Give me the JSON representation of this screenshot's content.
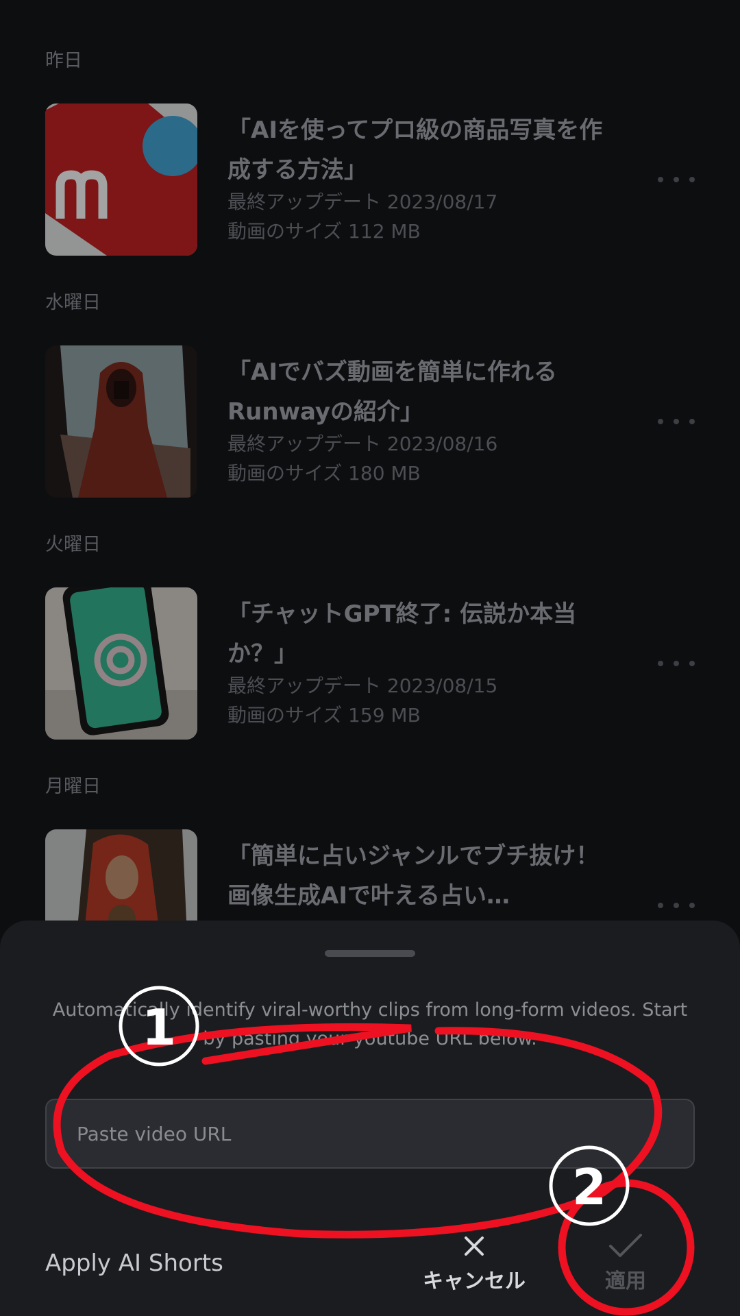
{
  "history": {
    "sections": [
      {
        "day": "昨日",
        "title": "「AIを使ってプロ級の商品写真を作成する方法」",
        "updated": "最終アップデート 2023/08/17",
        "size": "動画のサイズ 112 MB"
      },
      {
        "day": "水曜日",
        "title": "「AIでバズ動画を簡単に作れるRunwayの紹介」",
        "updated": "最終アップデート 2023/08/16",
        "size": "動画のサイズ 180 MB"
      },
      {
        "day": "火曜日",
        "title": "「チャットGPT終了: 伝説か本当か？」",
        "updated": "最終アップデート 2023/08/15",
        "size": "動画のサイズ 159 MB"
      },
      {
        "day": "月曜日",
        "title": "「簡単に占いジャンルでブチ抜け！画像生成AIで叶える占い…"
      }
    ]
  },
  "sheet": {
    "description": "Automatically identify viral-worthy clips from long-form videos. Start by pasting your youtube URL below.",
    "url_placeholder": "Paste video URL",
    "apply_label": "Apply AI Shorts",
    "cancel_label": "キャンセル",
    "confirm_label": "適用"
  },
  "annotations": {
    "step1": "1",
    "step2": "2",
    "color": "#ee1122"
  }
}
